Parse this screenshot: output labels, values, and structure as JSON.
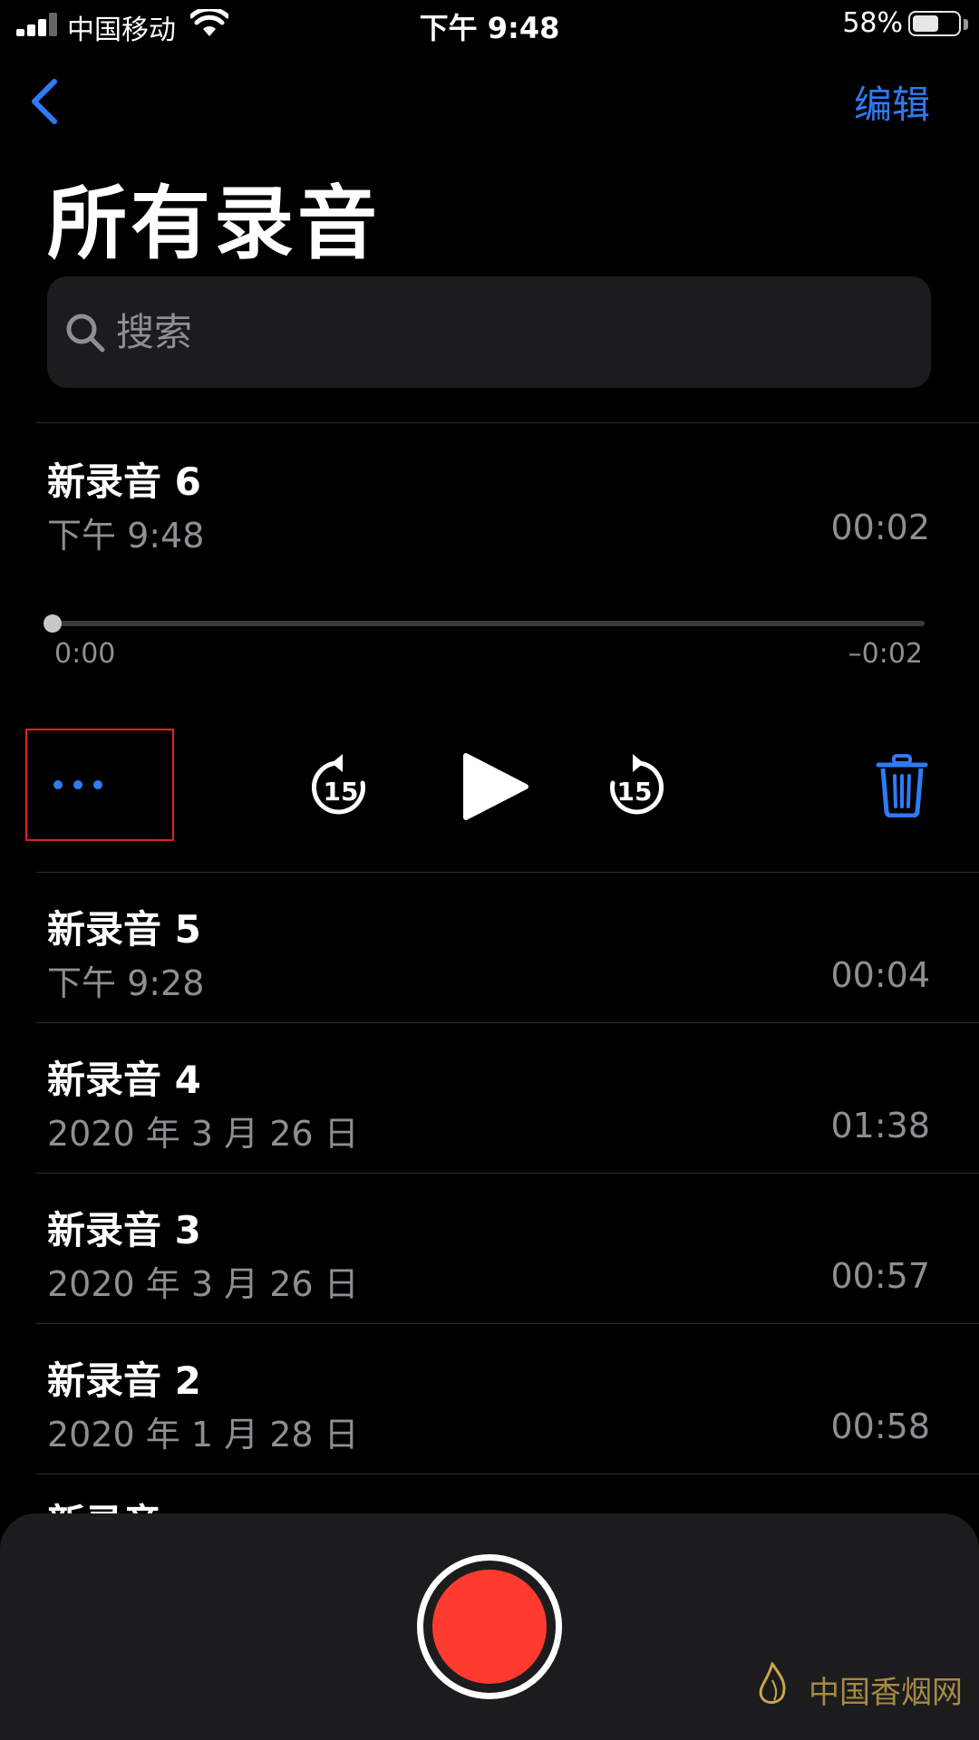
{
  "status": {
    "carrier": "中国移动",
    "time": "下午 9:48",
    "battery_pct": "58%",
    "battery_level": 0.58
  },
  "nav": {
    "edit_label": "编辑",
    "title": "所有录音"
  },
  "search": {
    "placeholder": "搜索"
  },
  "active": {
    "title": "新录音 6",
    "date": "下午 9:48",
    "duration": "00:02",
    "elapsed": "0:00",
    "remaining": "–0:02",
    "progress": 0,
    "skip_back": "15",
    "skip_forward": "15"
  },
  "recordings": [
    {
      "title": "新录音 5",
      "date": "下午 9:28",
      "duration": "00:04"
    },
    {
      "title": "新录音 4",
      "date": "2020 年 3 月 26 日",
      "duration": "01:38"
    },
    {
      "title": "新录音 3",
      "date": "2020 年 3 月 26 日",
      "duration": "00:57"
    },
    {
      "title": "新录音 2",
      "date": "2020 年 1 月 28 日",
      "duration": "00:58"
    }
  ],
  "partial_row": "新录音",
  "watermark": "中国香烟网",
  "colors": {
    "accent": "#2f7bf5",
    "record": "#ff3b30",
    "highlight": "#e02424"
  }
}
